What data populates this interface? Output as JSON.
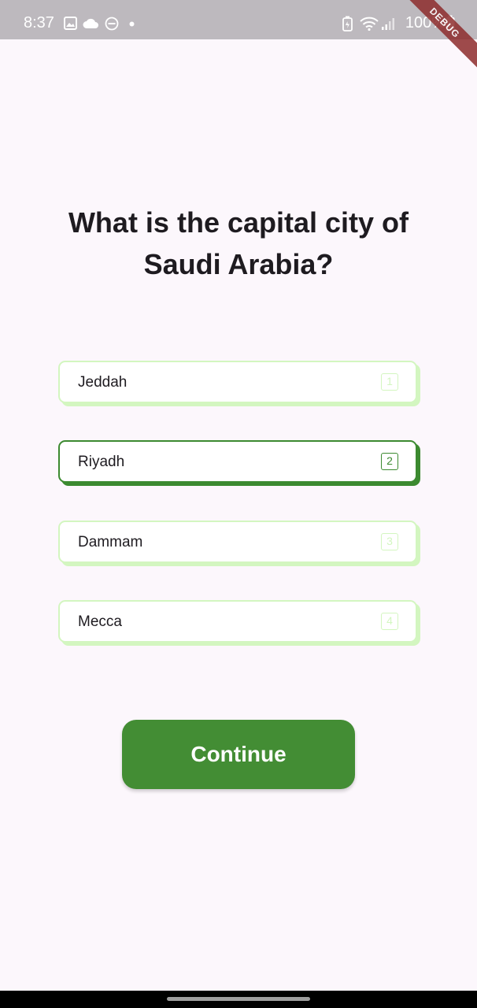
{
  "status_bar": {
    "time": "8:37",
    "battery": "100%",
    "debug_label": "DEBUG",
    "left_icons": [
      "image-icon",
      "cloud-icon",
      "dnd-icon",
      "dot-icon"
    ],
    "right_icons": [
      "battery-saver-icon",
      "wifi-icon",
      "signal-icon",
      "battery-icon"
    ]
  },
  "quiz": {
    "question": "What is the capital city of Saudi Arabia?",
    "options": [
      {
        "label": "Jeddah",
        "key": "1",
        "selected": false
      },
      {
        "label": "Riyadh",
        "key": "2",
        "selected": true
      },
      {
        "label": "Dammam",
        "key": "3",
        "selected": false
      },
      {
        "label": "Mecca",
        "key": "4",
        "selected": false
      }
    ],
    "continue_label": "Continue"
  },
  "colors": {
    "accent_green": "#438d34",
    "option_border": "#d3f6c0",
    "selected_border": "#3c8a30",
    "background": "#fcf7fc",
    "status_bar": "#bdb9be"
  }
}
